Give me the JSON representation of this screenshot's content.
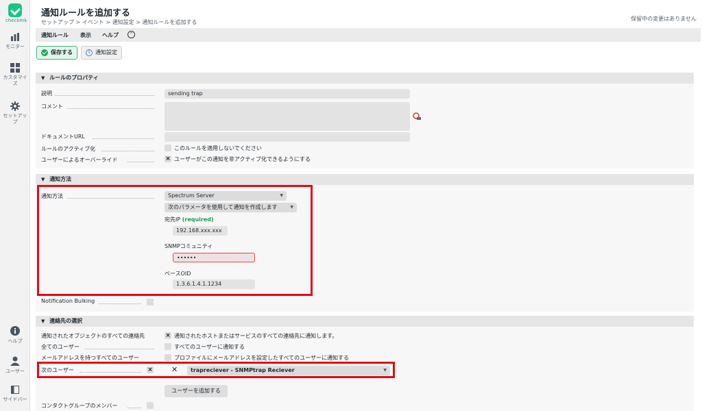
{
  "sidebar": {
    "logo": "checkmk",
    "items": [
      {
        "label": "モニター",
        "icon": "bar-chart-icon"
      },
      {
        "label": "カスタマイズ",
        "icon": "grid-icon"
      },
      {
        "label": "セットアップ",
        "icon": "gear-icon"
      },
      {
        "label": "ヘルプ",
        "icon": "info-icon"
      },
      {
        "label": "ユーザー",
        "icon": "user-icon"
      },
      {
        "label": "サイドバー",
        "icon": "sidebar-icon"
      }
    ]
  },
  "header": {
    "title": "通知ルールを追加する",
    "breadcrumb": "セットアップ > イベント > 通知設定 > 通知ルールを追加する",
    "pending": "保留中の変更はありません"
  },
  "menubar": {
    "items": [
      "通知ルール",
      "表示",
      "ヘルプ"
    ]
  },
  "toolbar": {
    "save_label": "保存する",
    "settings_label": "通知設定"
  },
  "rule_props": {
    "heading": "ルールのプロパティ",
    "description_label": "説明",
    "description_value": "sending trap",
    "comment_label": "コメント",
    "doc_url_label": "ドキュメントURL",
    "activation_label": "ルールのアクティブ化",
    "activation_text": "このルールを適用しないでください",
    "override_label": "ユーザーによるオーバーライド",
    "override_text": "ユーザーがこの通知を非アクティブ化できるようにする"
  },
  "method": {
    "heading": "通知方法",
    "label": "通知方法",
    "plugin_value": "Spectrum Server",
    "param_mode_value": "次のパラメータを使用して通知を作成します",
    "dest_ip_label": "宛先IP",
    "required": "(required)",
    "dest_ip_value": "192.168.xxx.xxx",
    "snmp_label": "SNMPコミュニティ",
    "snmp_value": "••••••",
    "oid_label": "ベースOID",
    "oid_value": "1.3.6.1.4.1.1234",
    "bulking_label": "Notification Bulking"
  },
  "contacts": {
    "heading": "連絡先の選択",
    "all_contacts_label": "通知されたオブジェクトのすべての連絡先",
    "all_contacts_text": "通知されたホストまたはサービスのすべての連絡先に通知します。",
    "all_users_label": "全てのユーザー",
    "all_users_text": "すべてのユーザーに通知する",
    "email_users_label": "メールアドレスを持つすべてのユーザー",
    "email_users_text": "プロファイルにメールアドレスを設定したすべてのユーザーに通知する",
    "next_users_label": "次のユーザー",
    "user_value": "trapreciever - SNMPtrap Reciever",
    "add_user_label": "ユーザーを追加する",
    "contact_group_label": "コンタクトグループのメンバー"
  },
  "colors": {
    "brand": "#16c784",
    "highlight": "#e50914"
  }
}
